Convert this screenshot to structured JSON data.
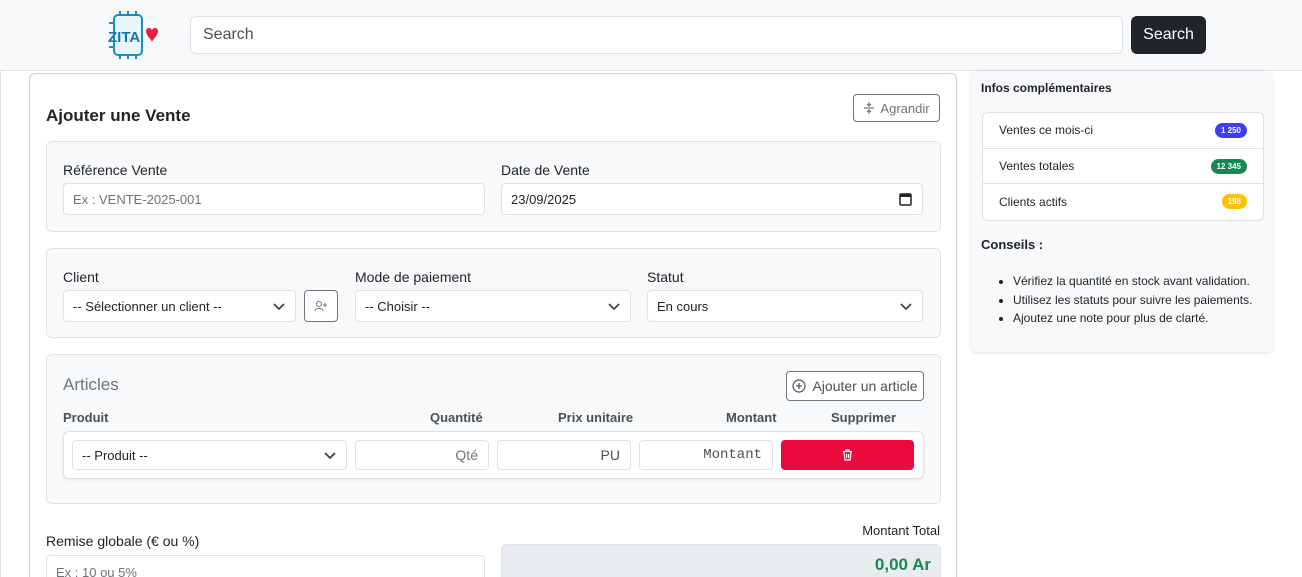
{
  "header": {
    "search_placeholder": "Search",
    "search_button": "Search",
    "logo_text": "ZITA"
  },
  "form": {
    "title": "Ajouter une Vente",
    "expand_button": "Agrandir",
    "reference": {
      "label": "Référence Vente",
      "placeholder": "Ex : VENTE-2025-001"
    },
    "date": {
      "label": "Date de Vente",
      "value": "23/09/2025"
    },
    "client": {
      "label": "Client",
      "value": "-- Sélectionner un client --"
    },
    "payment": {
      "label": "Mode de paiement",
      "value": "-- Choisir --"
    },
    "status": {
      "label": "Statut",
      "value": "En cours"
    },
    "articles": {
      "title": "Articles",
      "add_button": "Ajouter un article",
      "columns": [
        "Produit",
        "Quantité",
        "Prix unitaire",
        "Montant",
        "Supprimer"
      ],
      "row": {
        "product": "-- Produit --",
        "qty_placeholder": "Qté",
        "price_placeholder": "PU",
        "amount_placeholder": "Montant"
      }
    },
    "discount": {
      "label": "Remise globale (€ ou %)",
      "placeholder": "Ex : 10 ou 5%"
    },
    "total": {
      "label": "Montant Total",
      "value": "0,00 Ar"
    }
  },
  "sidebar": {
    "title": "Infos complémentaires",
    "stats": [
      {
        "label": "Ventes ce mois-ci",
        "value": "1 250",
        "color": "#3d3df5",
        "text_color": "#ffffff"
      },
      {
        "label": "Ventes totales",
        "value": "12 345",
        "color": "#198754",
        "text_color": "#ffffff"
      },
      {
        "label": "Clients actifs",
        "value": "198",
        "color": "#ffc107",
        "text_color": "#ffffff"
      }
    ],
    "tips_title": "Conseils :",
    "tips": [
      "Vérifiez la quantité en stock avant validation.",
      "Utilisez les statuts pour suivre les paiements.",
      "Ajoutez une note pour plus de clarté."
    ]
  }
}
